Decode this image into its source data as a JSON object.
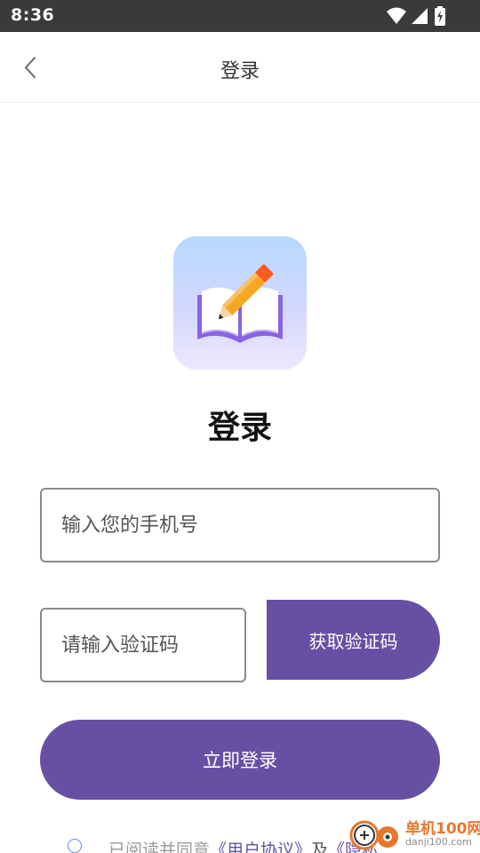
{
  "status_bar": {
    "time": "8:36",
    "icons": [
      "wifi-icon",
      "signal-icon",
      "battery-charging-icon"
    ]
  },
  "nav": {
    "back_icon": "chevron-left-icon",
    "title": "登录"
  },
  "logo": {
    "icon": "book-pencil-logo",
    "colors": {
      "gradient_top": "#b7d8ff",
      "gradient_bottom": "#eee6ff",
      "book": "#8a63e6",
      "pencil": "#f5a623",
      "eraser": "#ff5a1f"
    }
  },
  "heading": "登录",
  "form": {
    "phone_placeholder": "输入您的手机号",
    "code_placeholder": "请输入验证码",
    "get_code_label": "获取验证码",
    "login_label": "立即登录"
  },
  "agreement": {
    "prefix": "已阅读并同意",
    "user_agreement": "《用户协议》",
    "conjunction": "及",
    "privacy_partial": "《隐私"
  },
  "watermark": {
    "title": "单机100网",
    "url": "danji100.com"
  },
  "colors": {
    "primary": "#6750a4",
    "status_bar": "#3a3a3a",
    "input_border": "#8a8a8a",
    "radio_border": "#5a8fe0"
  }
}
